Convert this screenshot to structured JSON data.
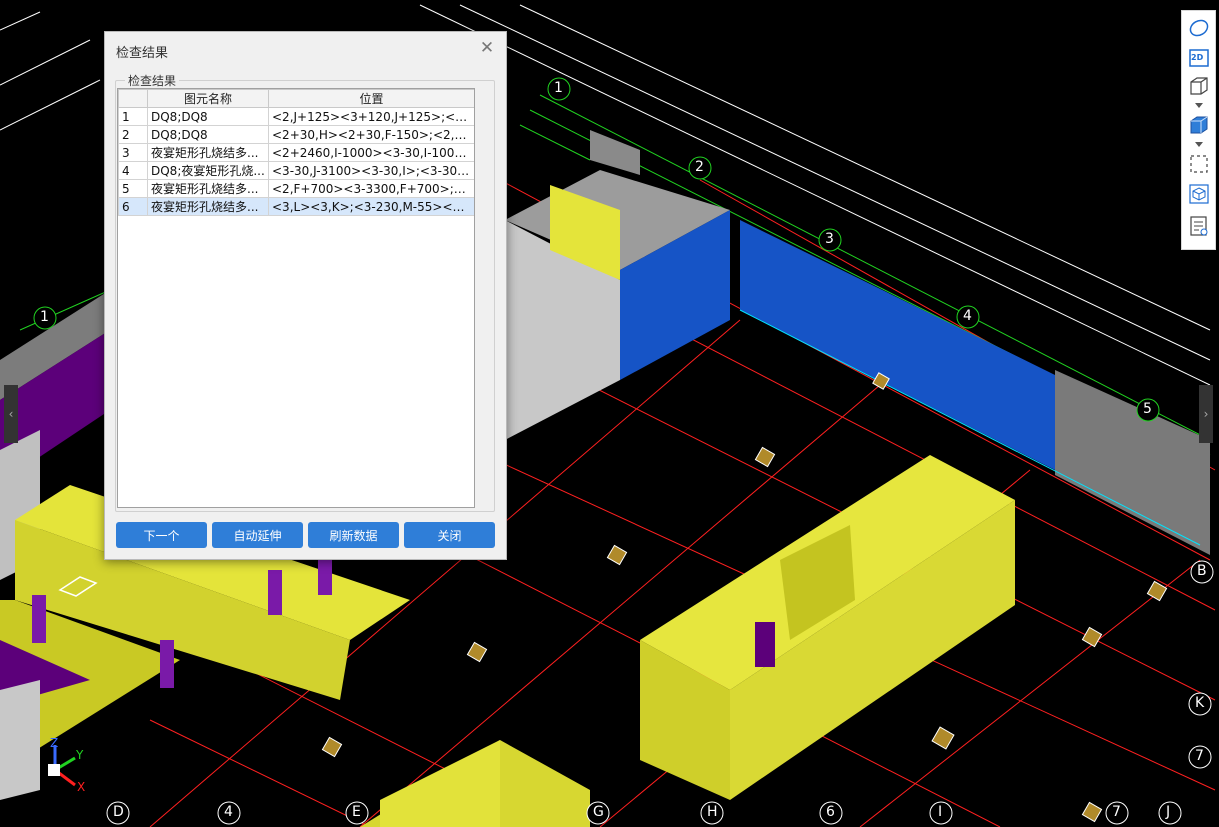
{
  "dialog": {
    "title": "检查结果",
    "group_title": "检查结果",
    "columns": [
      "",
      "图元名称",
      "位置"
    ],
    "rows": [
      {
        "no": "1",
        "name": "DQ8;DQ8",
        "position": "<2,J+125><3+120,J+125>;<3-3..."
      },
      {
        "no": "2",
        "name": "DQ8;DQ8",
        "position": "<2+30,H><2+30,F-150>;<2,H+..."
      },
      {
        "no": "3",
        "name": "夜宴矩形孔烧结多...",
        "position": "<2+2460,I-1000><3-30,I-1000>..."
      },
      {
        "no": "4",
        "name": "DQ8;夜宴矩形孔烧...",
        "position": "<3-30,J-3100><3-30,I>;<3-30,I-..."
      },
      {
        "no": "5",
        "name": "夜宴矩形孔烧结多...",
        "position": "<2,F+700><3-3300,F+700>;<2,..."
      },
      {
        "no": "6",
        "name": "夜宴矩形孔烧结多...",
        "position": "<3,L><3,K>;<3-230,M-55><5,..."
      }
    ],
    "selected_row": 6,
    "buttons": {
      "next": "下一个",
      "auto_extend": "自动延伸",
      "refresh": "刷新数据",
      "close": "关闭"
    }
  },
  "toolbar": {
    "icons": [
      "orbit-icon",
      "view-2d-icon",
      "view-3d-icon",
      "cube-solid-icon",
      "selection-box-icon",
      "isometric-view-icon",
      "properties-list-icon"
    ],
    "label_2d": "2D"
  },
  "axis_triad": {
    "x": "X",
    "y": "Y",
    "z": "Z"
  },
  "axis_bubbles": [
    {
      "id": "bub-1",
      "label": "1"
    },
    {
      "id": "bub-2",
      "label": "2"
    },
    {
      "id": "bub-3",
      "label": "3"
    },
    {
      "id": "bub-4",
      "label": "4"
    },
    {
      "id": "bub-5",
      "label": "5"
    },
    {
      "id": "bub-1b",
      "label": "1"
    },
    {
      "id": "bub-D",
      "label": "D"
    },
    {
      "id": "bub-4b",
      "label": "4"
    },
    {
      "id": "bub-E",
      "label": "E"
    },
    {
      "id": "bub-G",
      "label": "G"
    },
    {
      "id": "bub-H",
      "label": "H"
    },
    {
      "id": "bub-6",
      "label": "6"
    },
    {
      "id": "bub-I",
      "label": "I"
    },
    {
      "id": "bub-7",
      "label": "7"
    },
    {
      "id": "bub-J",
      "label": "J"
    },
    {
      "id": "bub-7b",
      "label": "7"
    },
    {
      "id": "bub-K",
      "label": "K"
    },
    {
      "id": "bub-B",
      "label": "B"
    }
  ],
  "colors": {
    "accent": "#2f7ed8",
    "wall_yellow": "#d2d22e",
    "wall_blue": "#1654c6",
    "grid_red": "#ff2020",
    "grid_green": "#21d221"
  }
}
